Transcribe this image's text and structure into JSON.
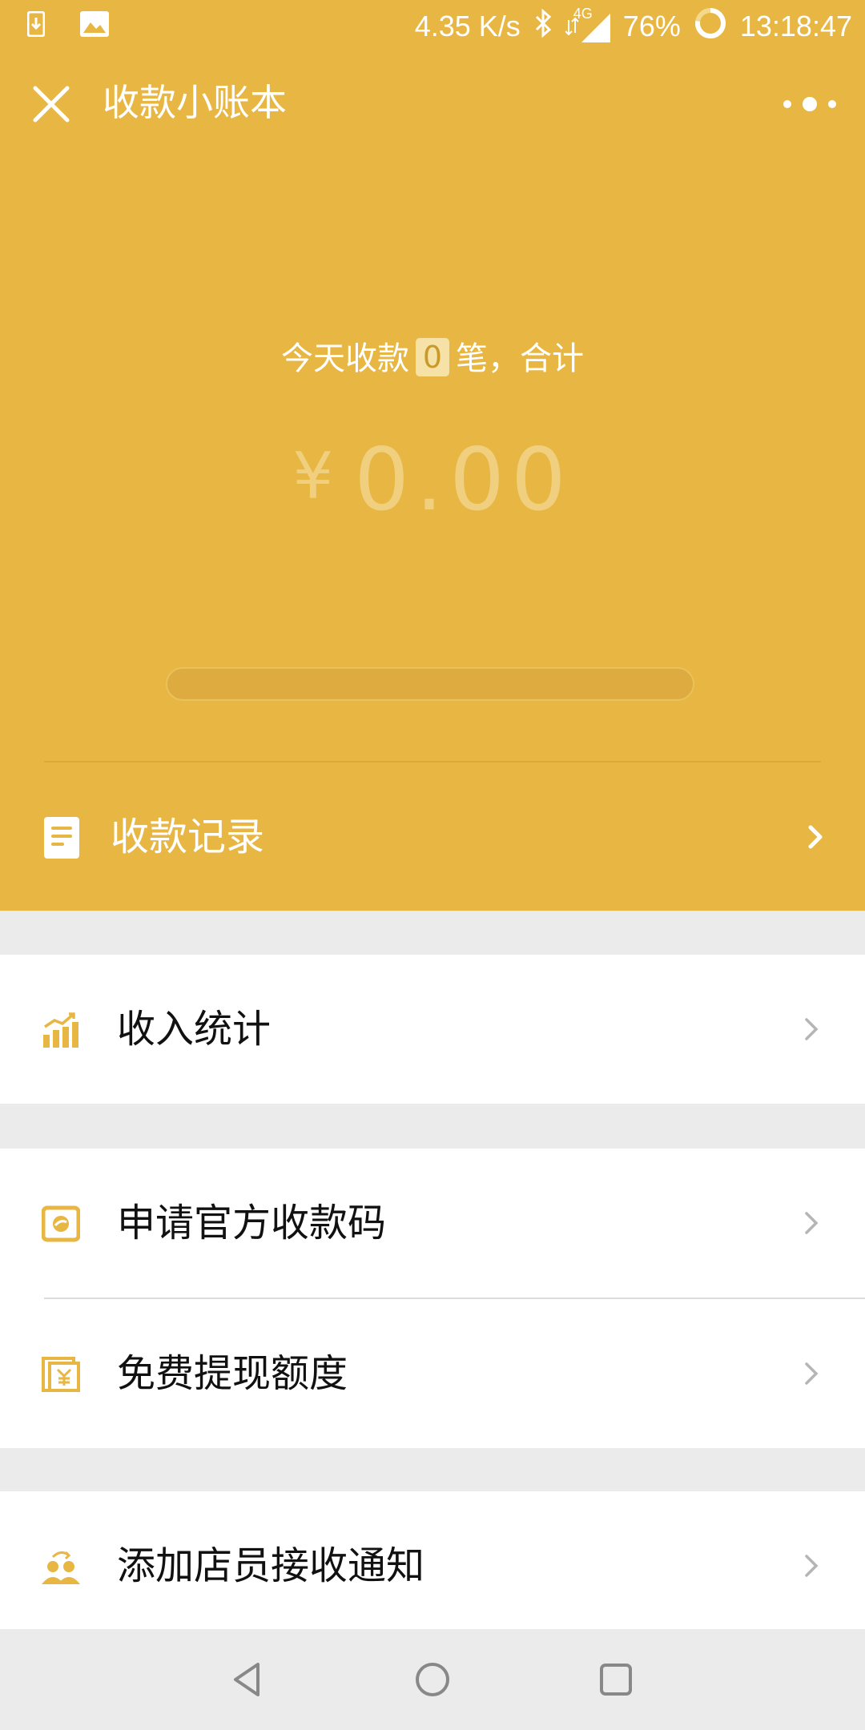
{
  "status_bar": {
    "network_speed": "4.35 K/s",
    "network_type": "4G",
    "battery": "76%",
    "time": "13:18:47",
    "icons": [
      "download-notification-icon",
      "image-notification-icon",
      "bluetooth-icon",
      "signal-icon",
      "battery-ring-icon"
    ]
  },
  "header": {
    "title": "收款小账本",
    "close_icon": "close-icon",
    "more_icon": "more-icon"
  },
  "summary": {
    "prefix": "今天收款",
    "count": "0",
    "suffix": "笔，合计",
    "currency": "¥",
    "amount": "0.00",
    "progress": 0
  },
  "record": {
    "label": "收款记录",
    "icon": "document-icon"
  },
  "menu_groups": [
    {
      "items": [
        {
          "label": "收入统计",
          "icon": "bar-chart-icon"
        }
      ]
    },
    {
      "items": [
        {
          "label": "申请官方收款码",
          "icon": "qr-code-icon"
        },
        {
          "label": "免费提现额度",
          "icon": "withdrawal-icon"
        }
      ]
    },
    {
      "items": [
        {
          "label": "添加店员接收通知",
          "icon": "staff-icon"
        }
      ]
    }
  ],
  "colors": {
    "brand_yellow": "#e8b643",
    "background": "#ebebeb",
    "text_dark": "#111111",
    "chevron_gray": "#b5b5b5"
  },
  "nav_bar": {
    "icons": [
      "back-icon",
      "home-icon",
      "recents-icon"
    ]
  }
}
